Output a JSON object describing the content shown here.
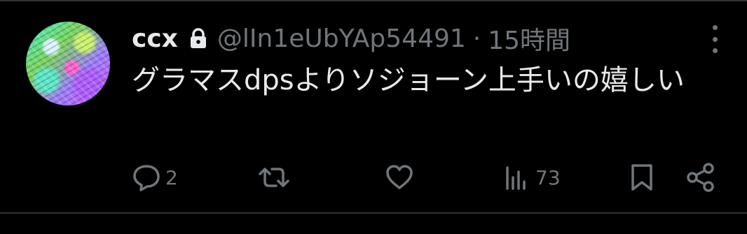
{
  "tweet": {
    "display_name": "ccx",
    "handle": "@lIn1eUbYAp54491",
    "separator": "·",
    "time": "15時間",
    "text": "グラマスdpsよりソジョーン上手いの嬉しい"
  },
  "actions": {
    "reply_count": "2",
    "retweet_count": "",
    "like_count": "",
    "views_count": "73"
  },
  "colors": {
    "background": "#000000",
    "text_primary": "#e7e9ea",
    "text_secondary": "#71767b",
    "divider": "#2f3336"
  },
  "icons": [
    "lock-icon",
    "more-icon",
    "reply-icon",
    "retweet-icon",
    "like-icon",
    "views-icon",
    "bookmark-icon",
    "share-icon"
  ]
}
